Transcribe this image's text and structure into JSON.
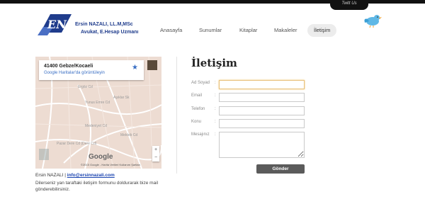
{
  "header": {
    "logo_name": "Ersin NAZALI, LL.M,MSc",
    "logo_subtitle": "Avukat, E.Hesap Uzmanı",
    "twitter_tab": "Twitt Us"
  },
  "nav": {
    "items": [
      {
        "label": "Anasayfa"
      },
      {
        "label": "Sunumlar"
      },
      {
        "label": "Kitaplar"
      },
      {
        "label": "Makaleler"
      },
      {
        "label": "İletişim"
      }
    ],
    "active": "İletişim"
  },
  "map": {
    "place": "41400 Gebze/Kocaeli",
    "link": "Google Haritalar'da görüntüleyin",
    "zoom_in": "+",
    "zoom_out": "−",
    "watermark": "Google",
    "footer": "©2015 Google - Harita Verileri   Kullanım Şartları",
    "streets": [
      "Yunus Emre Cd",
      "Pazar Dere Cd (Dere Cd)",
      "Ergöz Cd",
      "Aşıklar Sk",
      "Medeniyet Cd",
      "Mekteb Cd"
    ]
  },
  "contact": {
    "name": "Ersin NAZALI",
    "separator": "|",
    "email": "info@ersinnazali.com",
    "note": "Dilerseniz yan taraftaki iletişim formunu doldurarak bize mail gönderebilirsiniz."
  },
  "form": {
    "title": "İletişim",
    "fields": [
      {
        "label": "Ad Soyad",
        "value": ""
      },
      {
        "label": "Email",
        "value": ""
      },
      {
        "label": "Telefon",
        "value": ""
      },
      {
        "label": "Konu",
        "value": ""
      },
      {
        "label": "Mesajınız",
        "value": ""
      }
    ],
    "colon": ":",
    "submit_label": "Gönder"
  },
  "colors": {
    "brand": "#1f3c8c",
    "link": "#1a44b0",
    "button": "#5b5b5b"
  }
}
